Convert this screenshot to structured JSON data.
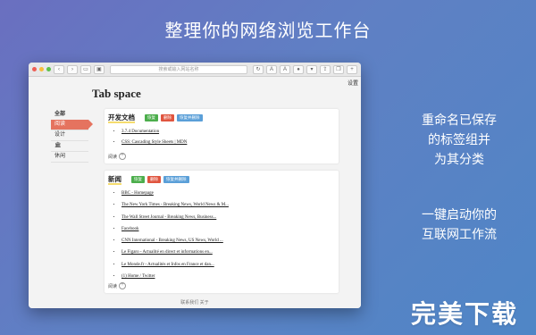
{
  "headline": "整理你的网络浏览工作台",
  "side_text_1": [
    "重命名已保存",
    "的标签组并",
    "为其分类"
  ],
  "side_text_2": [
    "一键启动你的",
    "互联网工作流"
  ],
  "brand": "完美下载",
  "browser": {
    "address_placeholder": "搜索或输入网站名称",
    "toolbar_icons": [
      "back-icon",
      "forward-icon",
      "sidebar-icon",
      "refresh-icon",
      "zoom-out-icon",
      "zoom-in-icon",
      "share-icon",
      "tabs-icon",
      "new-tab-icon"
    ],
    "zoom_small": "A",
    "zoom_large": "A"
  },
  "page": {
    "settings": "设置",
    "title": "Tab space",
    "nav": [
      "全部",
      "阅读",
      "设计",
      "🏛",
      "休闲"
    ],
    "active_nav": 1,
    "groups": [
      {
        "title": "开发文档",
        "tags": {
          "restore": "恢复",
          "delete": "删除",
          "restore_delete": "恢复并删除"
        },
        "links": [
          "3.7.4 Documentation",
          "CSS: Cascading Style Sheets | MDN"
        ],
        "footer": "阅读"
      },
      {
        "title": "新闻",
        "tags": {
          "restore": "恢复",
          "delete": "删除",
          "restore_delete": "恢复并删除"
        },
        "links": [
          "BBC - Homepage",
          "The New York Times - Breaking News, World News & M...",
          "The Wall Street Journal - Breaking News, Business...",
          "Facebook",
          "CNN International - Breaking News, US News, World ...",
          "Le Figaro - Actualité en direct et informations en...",
          "Le Monde.fr - Actualités et Infos en France et dan...",
          "(1) Home / Twitter"
        ],
        "footer": "阅读"
      }
    ],
    "bottom_text": "联系我们   关于"
  }
}
